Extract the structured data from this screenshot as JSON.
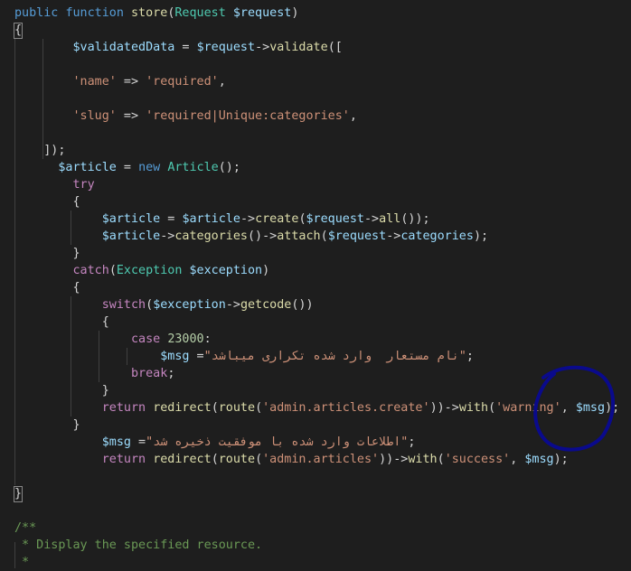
{
  "editor": {
    "theme": {
      "background": "#1e1e1e",
      "keyword": "#569cd6",
      "control": "#c586c0",
      "function": "#dcdcaa",
      "variable": "#9cdcfe",
      "string": "#ce9178",
      "class": "#4ec9b0",
      "number": "#b5cea8",
      "comment": "#6a9955",
      "annotation_ink": "#0a0a8c"
    },
    "lines": [
      [
        [
          "kw",
          "public "
        ],
        [
          "kw",
          "function "
        ],
        [
          "fn",
          "store"
        ],
        [
          "op",
          "("
        ],
        [
          "cls",
          "Request "
        ],
        [
          "var",
          "$request"
        ],
        [
          "op",
          ")"
        ]
      ],
      [
        [
          "op",
          "{"
        ]
      ],
      [
        [
          "op",
          "        "
        ],
        [
          "var",
          "$validatedData"
        ],
        [
          "op",
          " = "
        ],
        [
          "var",
          "$request"
        ],
        [
          "op",
          "->"
        ],
        [
          "fn",
          "validate"
        ],
        [
          "op",
          "(["
        ]
      ],
      [],
      [
        [
          "op",
          "        "
        ],
        [
          "str",
          "'name'"
        ],
        [
          "op",
          " => "
        ],
        [
          "str",
          "'required'"
        ],
        [
          "op",
          ","
        ]
      ],
      [],
      [
        [
          "op",
          "        "
        ],
        [
          "str",
          "'slug'"
        ],
        [
          "op",
          " => "
        ],
        [
          "str",
          "'required|Unique:categories'"
        ],
        [
          "op",
          ","
        ]
      ],
      [],
      [
        [
          "op",
          "    ]);"
        ]
      ],
      [
        [
          "op",
          "      "
        ],
        [
          "var",
          "$article"
        ],
        [
          "op",
          " = "
        ],
        [
          "kw",
          "new "
        ],
        [
          "cls",
          "Article"
        ],
        [
          "op",
          "();"
        ]
      ],
      [
        [
          "op",
          "        "
        ],
        [
          "ctl",
          "try"
        ]
      ],
      [
        [
          "op",
          "        {"
        ]
      ],
      [
        [
          "op",
          "            "
        ],
        [
          "var",
          "$article"
        ],
        [
          "op",
          " = "
        ],
        [
          "var",
          "$article"
        ],
        [
          "op",
          "->"
        ],
        [
          "fn",
          "create"
        ],
        [
          "op",
          "("
        ],
        [
          "var",
          "$request"
        ],
        [
          "op",
          "->"
        ],
        [
          "fn",
          "all"
        ],
        [
          "op",
          "());"
        ]
      ],
      [
        [
          "op",
          "            "
        ],
        [
          "var",
          "$article"
        ],
        [
          "op",
          "->"
        ],
        [
          "fn",
          "categories"
        ],
        [
          "op",
          "()->"
        ],
        [
          "fn",
          "attach"
        ],
        [
          "op",
          "("
        ],
        [
          "var",
          "$request"
        ],
        [
          "op",
          "->"
        ],
        [
          "var",
          "categories"
        ],
        [
          "op",
          ");"
        ]
      ],
      [
        [
          "op",
          "        }"
        ]
      ],
      [
        [
          "op",
          "        "
        ],
        [
          "ctl",
          "catch"
        ],
        [
          "op",
          "("
        ],
        [
          "cls",
          "Exception "
        ],
        [
          "var",
          "$exception"
        ],
        [
          "op",
          ")"
        ]
      ],
      [
        [
          "op",
          "        {"
        ]
      ],
      [
        [
          "op",
          "            "
        ],
        [
          "ctl",
          "switch"
        ],
        [
          "op",
          "("
        ],
        [
          "var",
          "$exception"
        ],
        [
          "op",
          "->"
        ],
        [
          "fn",
          "getcode"
        ],
        [
          "op",
          "())"
        ]
      ],
      [
        [
          "op",
          "            {"
        ]
      ],
      [
        [
          "op",
          "                "
        ],
        [
          "ctl",
          "case "
        ],
        [
          "num",
          "23000"
        ],
        [
          "op",
          ":"
        ]
      ],
      [
        [
          "op",
          "                    "
        ],
        [
          "var",
          "$msg"
        ],
        [
          "op",
          " ="
        ],
        [
          "str",
          "\""
        ],
        [
          "strrtl",
          "نام مستعار  وارد شده تکراری میباشد"
        ],
        [
          "str",
          "\""
        ],
        [
          "op",
          ";"
        ]
      ],
      [
        [
          "op",
          "                "
        ],
        [
          "ctl",
          "break"
        ],
        [
          "op",
          ";"
        ]
      ],
      [
        [
          "op",
          "            }"
        ]
      ],
      [
        [
          "op",
          "            "
        ],
        [
          "ctl",
          "return "
        ],
        [
          "fn",
          "redirect"
        ],
        [
          "op",
          "("
        ],
        [
          "fn",
          "route"
        ],
        [
          "op",
          "("
        ],
        [
          "str",
          "'admin.articles.create'"
        ],
        [
          "op",
          "))->"
        ],
        [
          "fn",
          "with"
        ],
        [
          "op",
          "("
        ],
        [
          "str",
          "'warning'"
        ],
        [
          "op",
          ", "
        ],
        [
          "var",
          "$msg"
        ],
        [
          "op",
          ");"
        ]
      ],
      [
        [
          "op",
          "        }"
        ]
      ],
      [
        [
          "op",
          "            "
        ],
        [
          "var",
          "$msg"
        ],
        [
          "op",
          " ="
        ],
        [
          "str",
          "\""
        ],
        [
          "strrtl",
          "اطلاعات وارد شده با موفقیت ذخیره شد"
        ],
        [
          "str",
          "\""
        ],
        [
          "op",
          ";"
        ]
      ],
      [
        [
          "op",
          "            "
        ],
        [
          "ctl",
          "return "
        ],
        [
          "fn",
          "redirect"
        ],
        [
          "op",
          "("
        ],
        [
          "fn",
          "route"
        ],
        [
          "op",
          "("
        ],
        [
          "str",
          "'admin.articles'"
        ],
        [
          "op",
          "))->"
        ],
        [
          "fn",
          "with"
        ],
        [
          "op",
          "("
        ],
        [
          "str",
          "'success'"
        ],
        [
          "op",
          ", "
        ],
        [
          "var",
          "$msg"
        ],
        [
          "op",
          ");"
        ]
      ],
      [],
      [
        [
          "op",
          "}"
        ]
      ],
      [],
      [
        [
          "cmt",
          "/**"
        ]
      ],
      [
        [
          "cmt",
          " * Display the specified resource."
        ]
      ],
      [
        [
          "cmt",
          " *"
        ]
      ]
    ]
  }
}
